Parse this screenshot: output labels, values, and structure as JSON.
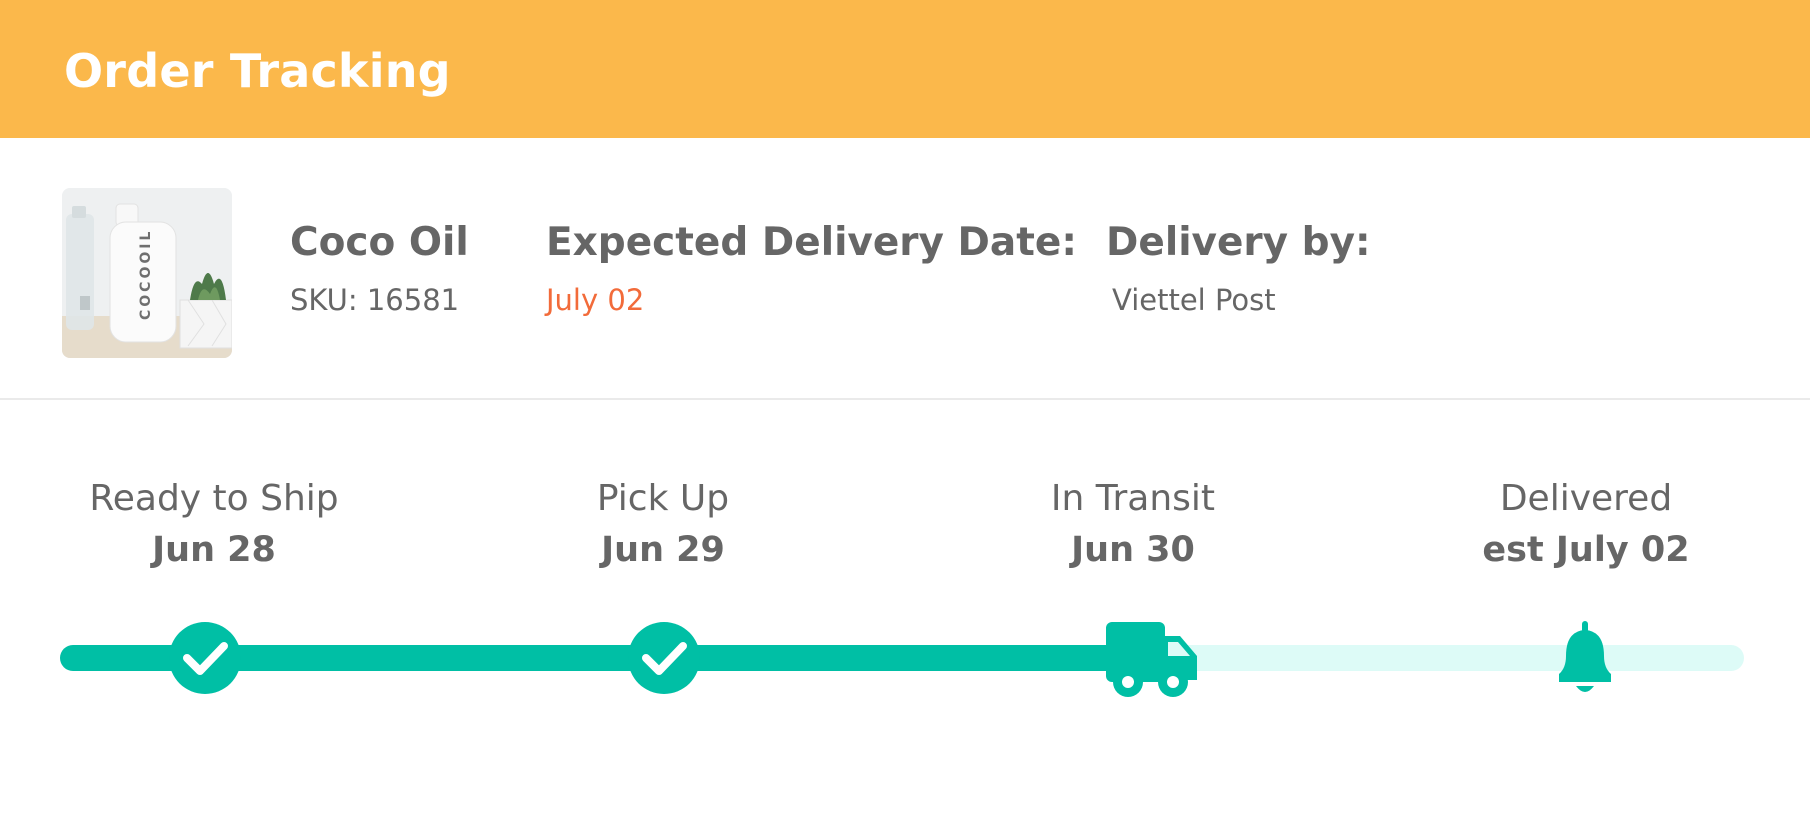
{
  "header": {
    "title": "Order Tracking"
  },
  "product": {
    "image_alt": "Coco Oil product photo",
    "bottle_brand": "COCOOIL",
    "name": "Coco Oil",
    "sku": "SKU: 16581"
  },
  "expected_delivery": {
    "label": "Expected Delivery Date:",
    "value": "July 02"
  },
  "carrier": {
    "label": "Delivery by:",
    "value": "Viettel Post"
  },
  "tracking": {
    "steps": [
      {
        "label": "Ready to Ship",
        "date": "Jun 28",
        "status": "completed",
        "icon": "check-icon"
      },
      {
        "label": "Pick Up",
        "date": "Jun 29",
        "status": "completed",
        "icon": "check-icon"
      },
      {
        "label": "In Transit",
        "date": "Jun 30",
        "status": "current",
        "icon": "truck-icon"
      },
      {
        "label": "Delivered",
        "date": "est July 02",
        "status": "pending",
        "icon": "bell-icon"
      }
    ]
  },
  "colors": {
    "header_bg": "#FBB84B",
    "accent_date": "#F26B3A",
    "progress": "#00BFA5",
    "progress_track": "#DDFBF7",
    "text": "#666666"
  }
}
